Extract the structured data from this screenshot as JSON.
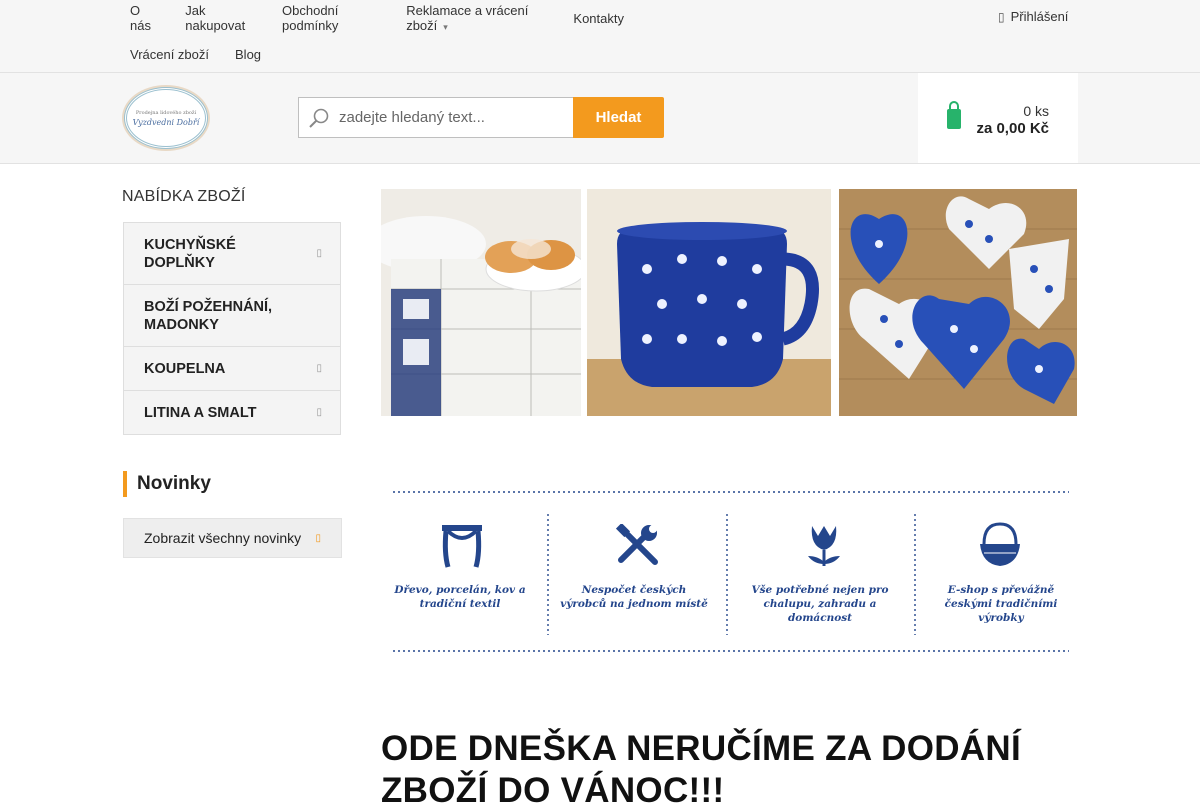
{
  "topnav": {
    "row1": [
      "O nás",
      "Jak nakupovat",
      "Obchodní podmínky",
      "Reklamace a vrácení zboží",
      "Kontakty"
    ],
    "row2": [
      "Vrácení zboží",
      "Blog"
    ],
    "login": "Přihlášení"
  },
  "header": {
    "logo_line1": "Prodejna lidového zboží",
    "logo_line2": "Vyzdvedni Dobří",
    "search_placeholder": "zadejte hledaný text...",
    "search_button": "Hledat",
    "cart_qty": "0 ks",
    "cart_sum": "za 0,00 Kč"
  },
  "sidebar": {
    "title": "NABÍDKA ZBOŽÍ",
    "categories": [
      "KUCHYŇSKÉ DOPLŇKY",
      "BOŽÍ POŽEHNÁNÍ, MADONKY",
      "KOUPELNA",
      "LITINA A SMALT"
    ],
    "novinky_title": "Novinky",
    "novinky_button": "Zobrazit všechny novinky"
  },
  "features": [
    "Dřevo, porcelán, kov a tradiční textil",
    "Nespočet českých výrobců na jednom místě",
    "Vše potřebné nejen pro chalupu, zahradu a domácnost",
    "E-shop s převážně českými tradičními výrobky"
  ],
  "headline": "ODE DNEŠKA NERUČÍME ZA DODÁNÍ ZBOŽÍ DO VÁNOC!!!",
  "colors": {
    "accent": "#f39a1e",
    "cart_icon": "#27b36b",
    "feature_blue": "#24468c"
  }
}
